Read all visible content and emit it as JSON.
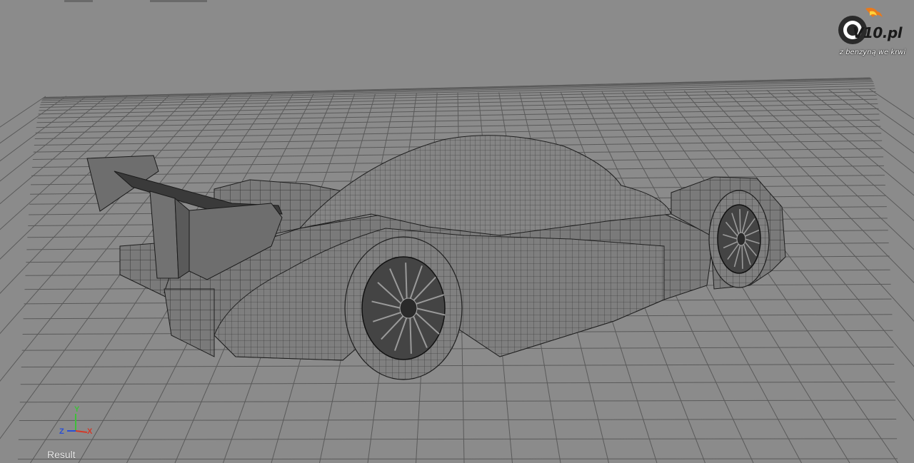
{
  "viewport": {
    "view_label": "Result"
  },
  "axis_gizmo": {
    "x_label": "X",
    "y_label": "Y",
    "z_label": "Z",
    "x_color": "#d23a2a",
    "y_color": "#3fbf3a",
    "z_color": "#2a4fd6"
  },
  "watermark": {
    "brand": "V10.pl",
    "tagline": "z benzyną we krwi"
  },
  "colors": {
    "background": "#8b8b8b",
    "grid": "#5a5a5a",
    "mesh_fill": "#7d7d7d",
    "mesh_line": "#222222"
  }
}
